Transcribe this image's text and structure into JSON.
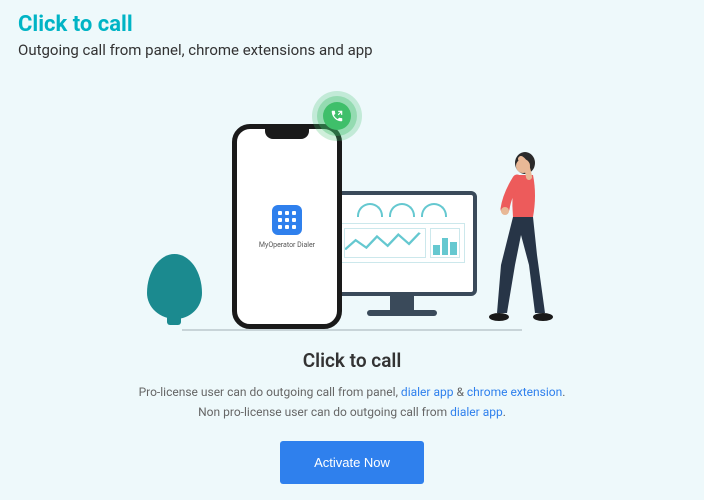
{
  "header": {
    "title": "Click to call",
    "subtitle": "Outgoing call from panel, chrome extensions and app"
  },
  "phone": {
    "app_label": "MyOperator Dialer"
  },
  "content": {
    "title": "Click to call",
    "desc_part1": "Pro-license user can do outgoing call from panel, ",
    "link1": "dialer app",
    "desc_amp": " & ",
    "link2": "chrome extension",
    "desc_part2": ".",
    "desc_line2a": "Non pro-license user can do outgoing call from ",
    "link3": "dialer app",
    "desc_line2b": "."
  },
  "button": {
    "activate": "Activate Now"
  }
}
